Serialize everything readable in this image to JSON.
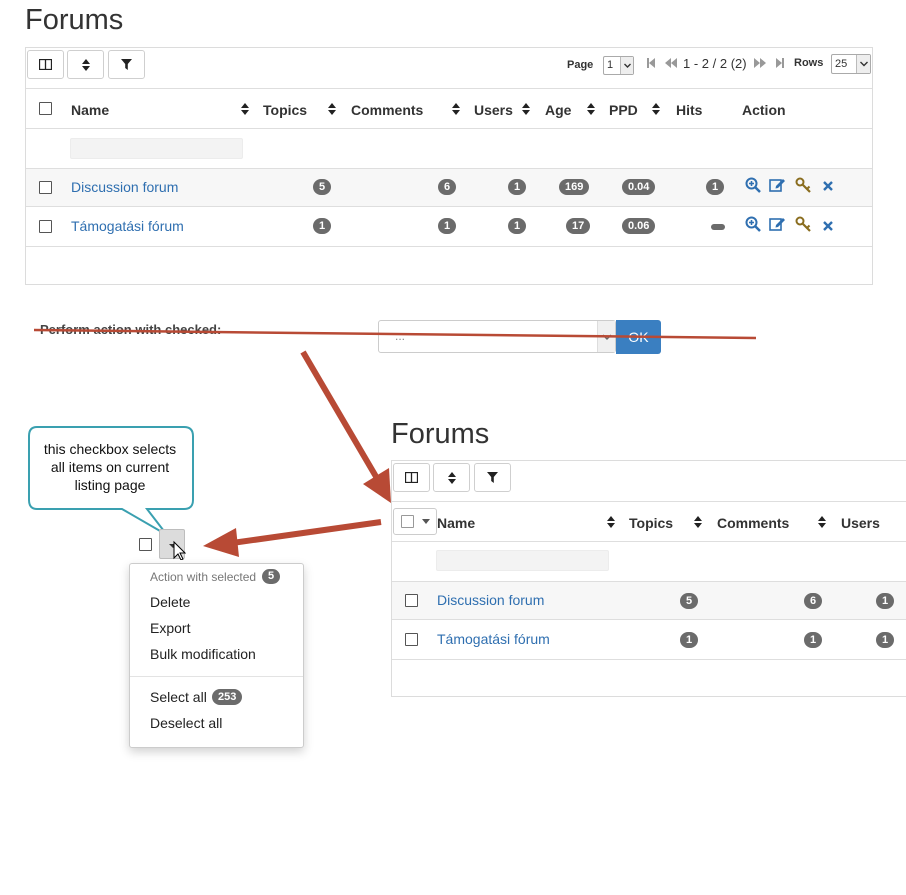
{
  "top": {
    "title": "Forums",
    "toolbar": {
      "columns_icon": "columns-icon",
      "sort_icon": "sort-icon",
      "filter_icon": "filter-icon"
    },
    "pagination": {
      "page_label": "Page",
      "page_value": "1",
      "range": "1 - 2 / 2 (2)",
      "rows_label": "Rows",
      "rows_value": "25"
    },
    "columns": [
      "Name",
      "Topics",
      "Comments",
      "Users",
      "Age",
      "PPD",
      "Hits",
      "Action"
    ],
    "rows": [
      {
        "name": "Discussion forum",
        "topics": "5",
        "comments": "6",
        "users": "1",
        "age": "169",
        "ppd": "0.04",
        "hits": "1"
      },
      {
        "name": "Támogatási fórum",
        "topics": "1",
        "comments": "1",
        "users": "1",
        "age": "17",
        "ppd": "0.06",
        "hits": ""
      }
    ]
  },
  "perform": {
    "label": "Perform action with checked:",
    "select_value": "...",
    "ok_label": "OK"
  },
  "callout": {
    "text_lines": [
      "this checkbox selects",
      "all items on current",
      "listing page"
    ]
  },
  "dropdown": {
    "header": "Action with selected",
    "header_count": "5",
    "items": [
      "Delete",
      "Export",
      "Bulk modification"
    ],
    "select_all": "Select all",
    "select_all_count": "253",
    "deselect_all": "Deselect all"
  },
  "bottom": {
    "title": "Forums",
    "columns": [
      "Name",
      "Topics",
      "Comments",
      "Users"
    ],
    "rows": [
      {
        "name": "Discussion forum",
        "topics": "5",
        "comments": "6",
        "users": "1"
      },
      {
        "name": "Támogatási fórum",
        "topics": "1",
        "comments": "1",
        "users": "1"
      }
    ]
  },
  "colors": {
    "link": "#2f6fb0",
    "badge": "#6b6b6b",
    "arrow": "#c0392b",
    "callout_border": "#3aa0b0",
    "ok": "#3a7fc1"
  }
}
